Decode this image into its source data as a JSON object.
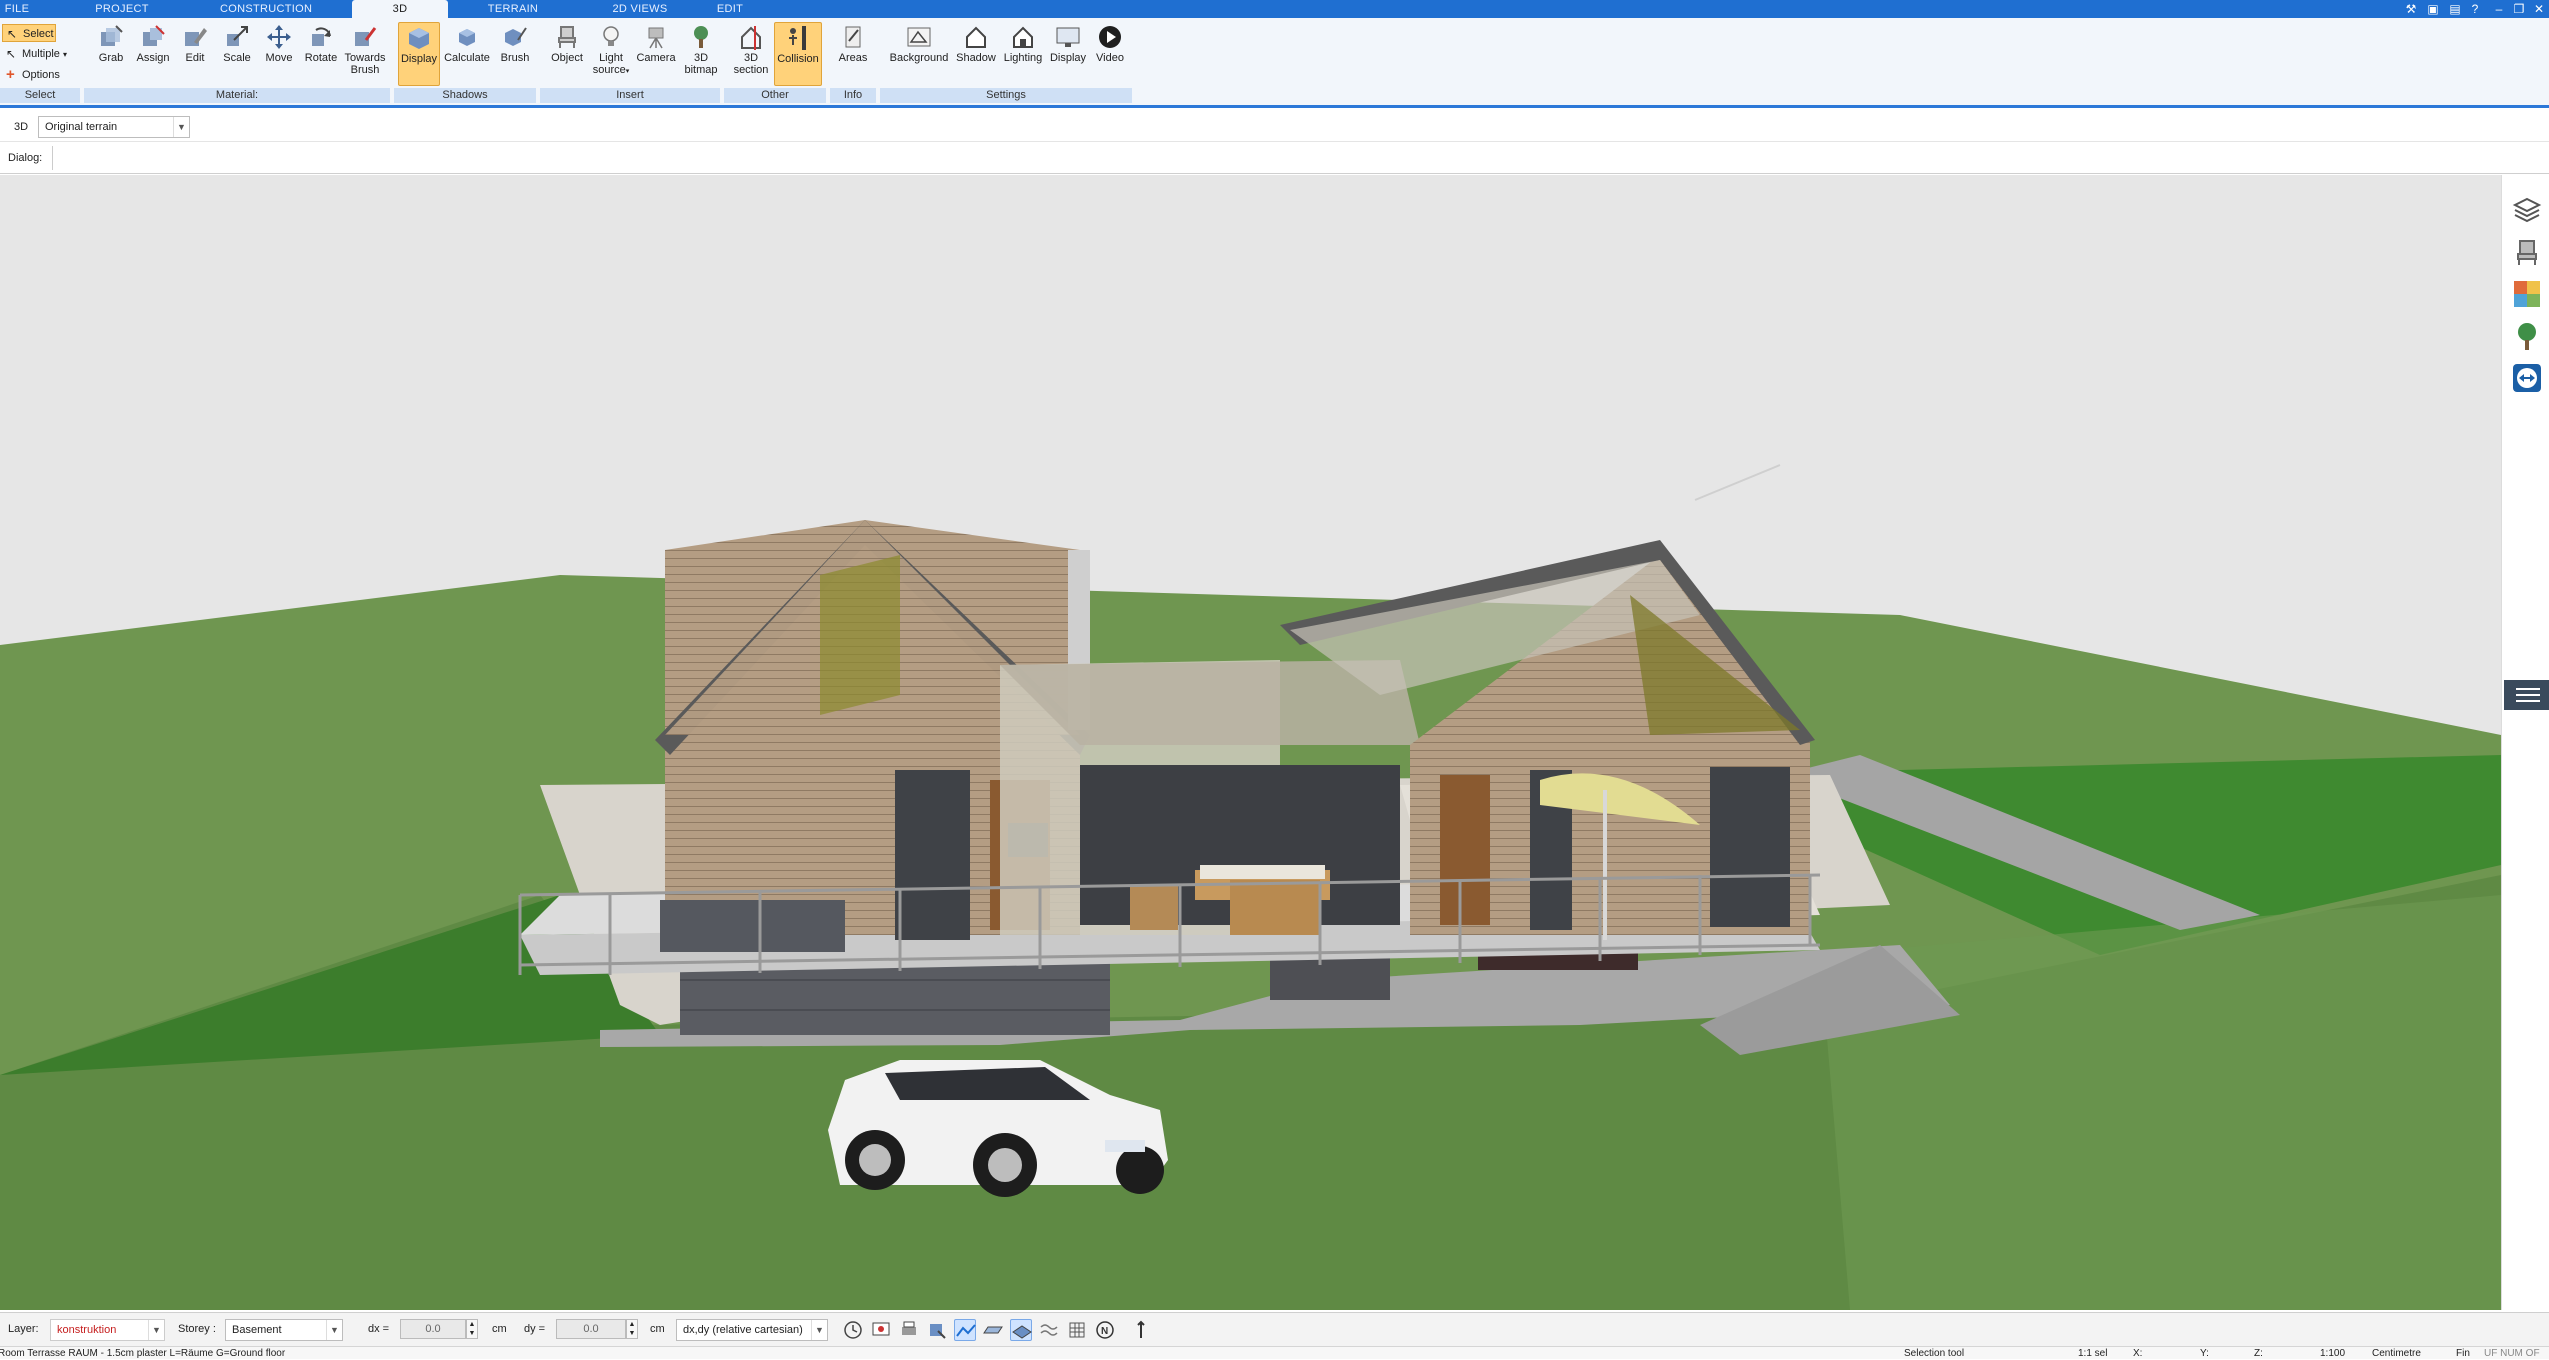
{
  "tabs": [
    {
      "label": "FILE",
      "active": false
    },
    {
      "label": "PROJECT",
      "active": false
    },
    {
      "label": "CONSTRUCTION",
      "active": false
    },
    {
      "label": "3D",
      "active": true
    },
    {
      "label": "TERRAIN",
      "active": false
    },
    {
      "label": "2D VIEWS",
      "active": false
    },
    {
      "label": "EDIT",
      "active": false
    }
  ],
  "ribbon": {
    "select_group": {
      "select": "Select",
      "multiple": "Multiple",
      "options": "Options",
      "label": "Select"
    },
    "material": {
      "label": "Material:",
      "grab": "Grab",
      "assign": "Assign",
      "edit": "Edit",
      "scale": "Scale",
      "move": "Move",
      "rotate": "Rotate",
      "towards_brush_1": "Towards",
      "towards_brush_2": "Brush"
    },
    "shadows": {
      "label": "Shadows",
      "display": "Display",
      "calculate": "Calculate",
      "brush": "Brush"
    },
    "insert": {
      "label": "Insert",
      "object": "Object",
      "light_1": "Light",
      "light_2": "source",
      "camera": "Camera",
      "bitmap_1": "3D",
      "bitmap_2": "bitmap"
    },
    "other": {
      "label": "Other",
      "section_1": "3D",
      "section_2": "section",
      "collision": "Collision"
    },
    "info": {
      "label": "Info",
      "areas": "Areas"
    },
    "settings": {
      "label": "Settings",
      "background": "Background",
      "shadow": "Shadow",
      "lighting": "Lighting",
      "display": "Display",
      "video": "Video"
    }
  },
  "view_row": {
    "mode": "3D",
    "terrain_select": "Original terrain"
  },
  "dialog_row": {
    "label": "Dialog:"
  },
  "options_bar": {
    "layer_label": "Layer:",
    "layer_value": "konstruktion",
    "storey_label": "Storey :",
    "storey_value": "Basement",
    "dx_label": "dx =",
    "dx_value": "0.0",
    "dx_unit": "cm",
    "dy_label": "dy =",
    "dy_value": "0.0",
    "dy_unit": "cm",
    "coord_mode": "dx,dy (relative cartesian)"
  },
  "status_bar": {
    "message": "Room Terrasse RAUM - 1.5cm plaster L=Räume G=Ground floor",
    "tool": "Selection tool",
    "selection": "1:1 sel",
    "x_label": "X:",
    "y_label": "Y:",
    "z_label": "Z:",
    "scale": "1:100",
    "unit": "Centimetre",
    "fin": "Fin",
    "caps": "UF NUM OF"
  },
  "colors": {
    "accent": "#1f6fd1",
    "ribbon_bg": "#f2f6fb",
    "active_button": "#ffd27a",
    "grass": "#6f9650",
    "sky": "#e6e6e6"
  }
}
